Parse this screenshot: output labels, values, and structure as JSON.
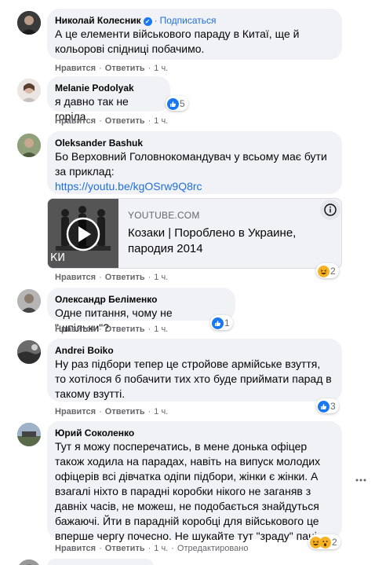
{
  "actions": {
    "like": "Нравится",
    "reply": "Ответить"
  },
  "comments": [
    {
      "author": "Николай Колесник",
      "subscribe": "Подписаться",
      "text": "А це елементи військового параду в Китаї, ще й кольорові спідниці побачимо.",
      "time": "1 ч."
    },
    {
      "author": "Melanie Podolyak",
      "text": "я давно так не горіла",
      "time": "1 ч.",
      "reaction_count": "5"
    },
    {
      "author": "Oleksander Bashuk",
      "text": "Бо Верховний Головнокомандувач у всьому має бути за приклад:",
      "link": "https://youtu.be/kgOSrw9Q8rc",
      "preview": {
        "domain": "YOUTUBE.COM",
        "title": "Козаки | Поробленo в Украине, пародия 2014",
        "thumb_text": "КИ"
      },
      "time": "1 ч.",
      "reaction_count": "2"
    },
    {
      "author": "Олександр Беліменко",
      "text": "Одне питання, чому не \"шпільки\"?",
      "time": "1 ч.",
      "reaction_count": "1"
    },
    {
      "author": "Andrei Boiko",
      "text": "Ну раз підбори тепер це стройове армійське взуття, то хотілося б побачити тих хто буде приймати парад в такому взутті.",
      "time": "1 ч.",
      "reaction_count": "3"
    },
    {
      "author": "Юрий Соколенко",
      "text": "Тут я можу посперечатись, в мене донька офіцер також ходила на парадах, навіть на випуск молодих офіцерів всі дівчатка одіпи підбори, жінки є жінки. А взагалі ніхто в парадні коробки нікого не заганяв з давніх часів, не можеш, не подобається знайдуться бажаючі. Йти в парадній коробці для військового це вперше чергу почесно. Не шукайте тут \"зраду\" пані.",
      "time": "1 ч.",
      "edited": "Отредактировано",
      "reaction_count": "2"
    }
  ],
  "colors": {
    "link": "#216fdb",
    "bubble": "#f0f2f5",
    "meta": "#65676b",
    "like": "#1877f2",
    "haha": "#f7b125"
  }
}
